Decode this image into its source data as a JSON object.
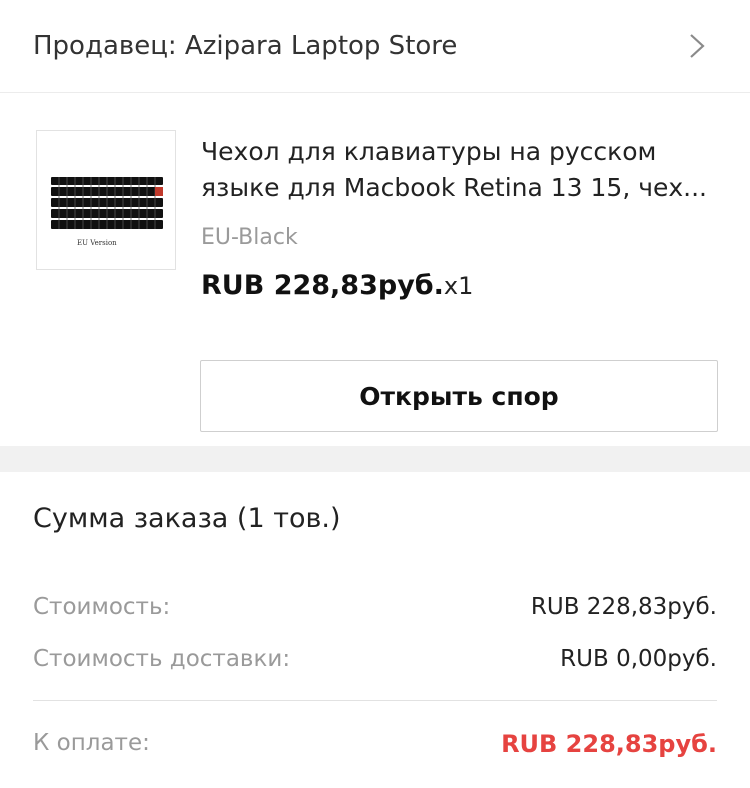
{
  "seller": {
    "label": "Продавец: Azipara Laptop Store",
    "chevron_icon": "chevron-right-icon"
  },
  "product": {
    "title_line1": "Чехол для клавиатуры на русском",
    "title_line2": "языке для Macbook Retina 13 15, чех...",
    "variant": "EU-Black",
    "price": "RUB 228,83руб.",
    "quantity": "x1",
    "thumb_caption": "EU Version",
    "dispute_button": "Открыть спор"
  },
  "summary": {
    "title": "Сумма заказа (1 тов.)",
    "cost_label": "Стоимость:",
    "cost_value": "RUB 228,83руб.",
    "shipping_label": "Стоимость доставки:",
    "shipping_value": "RUB 0,00руб.",
    "total_label": "К оплате:",
    "total_value": "RUB 228,83руб.",
    "total_color": "#e64340"
  }
}
